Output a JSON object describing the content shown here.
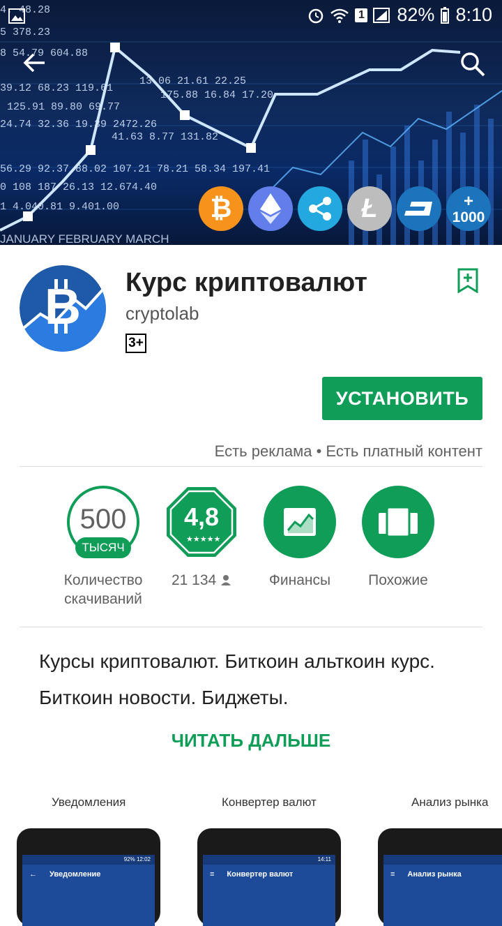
{
  "status_bar": {
    "battery": "82%",
    "time": "8:10",
    "sim_badge": "1"
  },
  "hero": {
    "coins": [
      "bitcoin-icon",
      "ethereum-icon",
      "ripple-icon",
      "litecoin-icon",
      "dash-icon"
    ],
    "more_coins_plus": "+",
    "more_coins_count": "1000"
  },
  "app": {
    "title": "Курс криптовалют",
    "developer": "cryptolab",
    "age_rating": "3+",
    "install_label": "УСТАНОВИТЬ",
    "ads_note": "Есть реклама • Есть платный контент"
  },
  "stats": {
    "downloads": {
      "value": "500",
      "unit": "ТЫСЯЧ",
      "label": "Количество скачиваний"
    },
    "rating": {
      "value": "4,8",
      "reviews": "21 134"
    },
    "category": {
      "label": "Финансы"
    },
    "similar": {
      "label": "Похожие"
    }
  },
  "description": {
    "text": "Курсы криптовалют. Биткоин альткоин курс. Биткоин новости. Биджеты.",
    "read_more": "ЧИТАТЬ ДАЛЬШЕ"
  },
  "screenshots": [
    {
      "caption": "Уведомления",
      "status": "92% 12:02",
      "bar_title": "Уведомление"
    },
    {
      "caption": "Конвертер валют",
      "status": "14:11",
      "bar_title": "Конвертер валют"
    },
    {
      "caption": "Анализ рынка",
      "status": "",
      "bar_title": "Анализ рынка"
    }
  ],
  "colors": {
    "accent": "#109d58",
    "hero_bg": "#0f2a5c",
    "bitcoin": "#f7931a"
  }
}
